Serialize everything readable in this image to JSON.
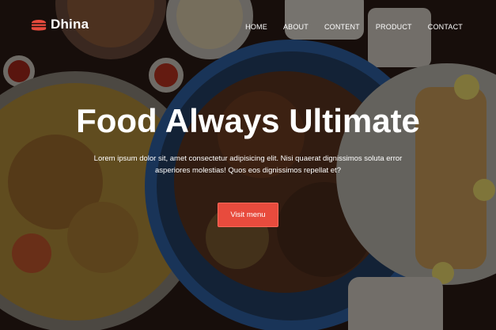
{
  "brand": {
    "name": "Dhina",
    "accent_color": "#e84b3d",
    "logo_icon": "burger-icon"
  },
  "nav": {
    "items": [
      "HOME",
      "ABOUT",
      "CONTENT",
      "PRODUCT",
      "CONTACT"
    ]
  },
  "hero": {
    "title": "Food Always Ultimate",
    "subtitle": "Lorem ipsum dolor sit, amet consectetur adipisicing elit. Nisi quaerat dignissimos soluta error asperiores molestias! Quos eos dignissimos repellat et?",
    "cta_label": "Visit menu",
    "background": "food-platter-image"
  }
}
